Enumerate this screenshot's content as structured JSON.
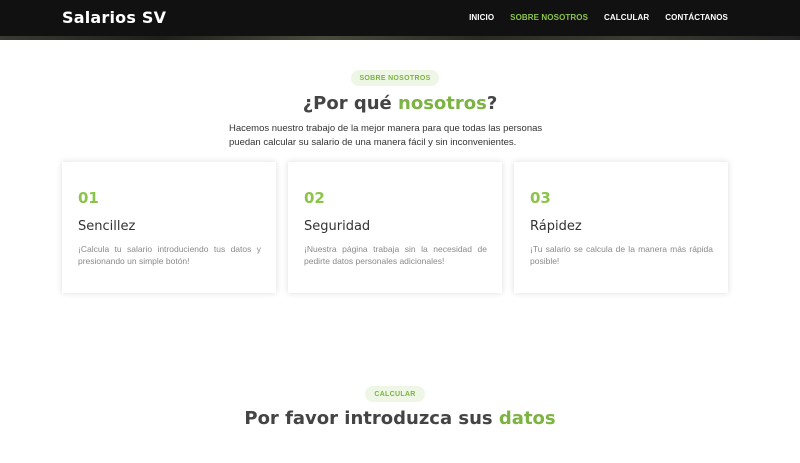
{
  "header": {
    "brand": "Salarios SV",
    "nav": [
      {
        "label": "INICIO",
        "active": false
      },
      {
        "label": "SOBRE NOSOTROS",
        "active": true
      },
      {
        "label": "CALCULAR",
        "active": false
      },
      {
        "label": "CONTÁCTANOS",
        "active": false
      }
    ]
  },
  "about": {
    "pill": "SOBRE NOSOTROS",
    "title_prefix": "¿Por qué ",
    "title_accent": "nosotros",
    "title_suffix": "?",
    "intro": "Hacemos nuestro trabajo de la mejor manera para que todas las personas puedan calcular su salario de una manera fácil y sin inconvenientes.",
    "cards": [
      {
        "number": "01",
        "title": "Sencillez",
        "description": "¡Calcula tu salario introduciendo tus datos y presionando un simple botón!"
      },
      {
        "number": "02",
        "title": "Seguridad",
        "description": "¡Nuestra página trabaja sin la necesidad de pedirte datos personales adicionales!"
      },
      {
        "number": "03",
        "title": "Rápidez",
        "description": "¡Tu salario se calcula de la manera más rápida posible!"
      }
    ]
  },
  "calculate": {
    "pill": "CALCULAR",
    "title_prefix": "Por favor introduzca sus ",
    "title_accent": "datos"
  },
  "colors": {
    "accent": "#7cb342",
    "header_bg": "#111111"
  }
}
